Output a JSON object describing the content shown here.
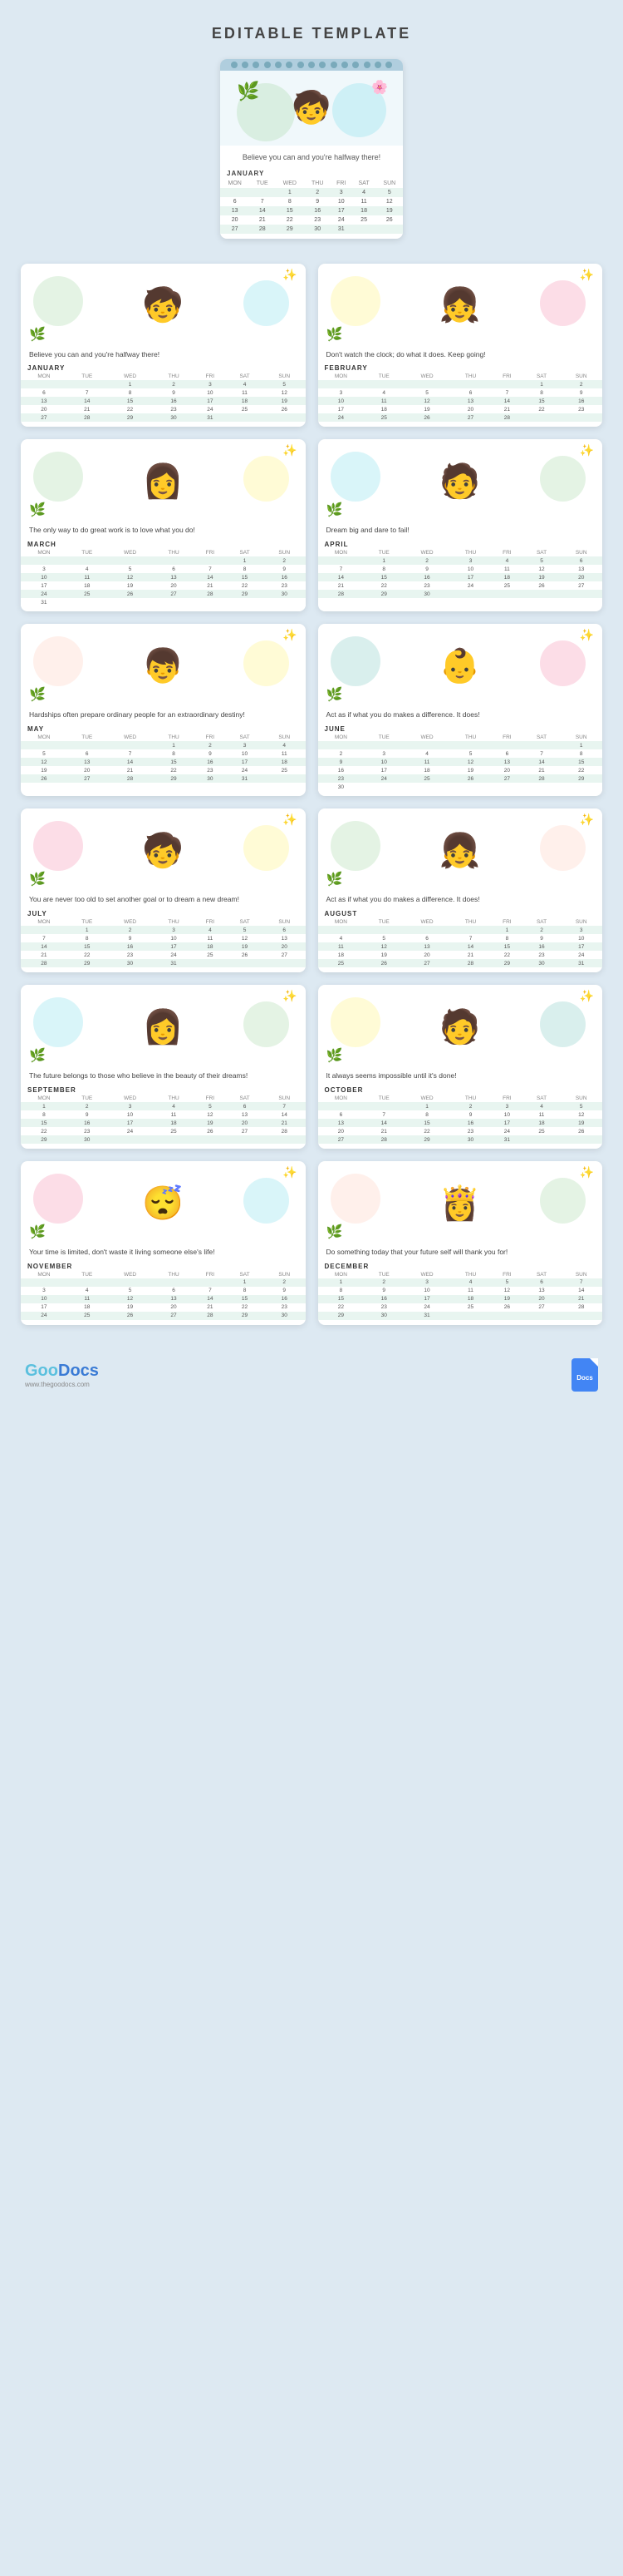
{
  "page": {
    "title": "EDITABLE TEMPLATE",
    "bg_color": "#dde9f2"
  },
  "hero": {
    "quote": "Believe you can\nand you're halfway there!",
    "month": "JANUARY",
    "days": [
      "MON",
      "TUE",
      "WED",
      "THU",
      "FRI",
      "SAT",
      "SUN"
    ],
    "weeks": [
      [
        "",
        "",
        "1",
        "2",
        "3",
        "4",
        "5"
      ],
      [
        "6",
        "7",
        "8",
        "9",
        "10",
        "11",
        "12"
      ],
      [
        "13",
        "14",
        "15",
        "16",
        "17",
        "18",
        "19"
      ],
      [
        "20",
        "21",
        "22",
        "23",
        "24",
        "25",
        "26"
      ],
      [
        "27",
        "28",
        "29",
        "30",
        "31",
        "",
        ""
      ]
    ]
  },
  "cards": [
    {
      "id": "jan",
      "quote": "Believe you can\nand you're halfway there!",
      "month": "JANUARY",
      "days": [
        "MON",
        "TUE",
        "WED",
        "THU",
        "FRI",
        "SAT",
        "SUN"
      ],
      "weeks": [
        [
          "",
          "",
          "1",
          "2",
          "3",
          "4",
          "5"
        ],
        [
          "6",
          "7",
          "8",
          "9",
          "10",
          "11",
          "12"
        ],
        [
          "13",
          "14",
          "15",
          "16",
          "17",
          "18",
          "19"
        ],
        [
          "20",
          "21",
          "22",
          "23",
          "24",
          "25",
          "26"
        ],
        [
          "27",
          "28",
          "29",
          "30",
          "31",
          "",
          ""
        ]
      ],
      "emoji": "🧒",
      "blob1": "blob-green",
      "blob2": "blob-blue"
    },
    {
      "id": "feb",
      "quote": "Don't watch the clock; do what it\ndoes. Keep going!",
      "month": "FEBRUARY",
      "days": [
        "MON",
        "TUE",
        "WED",
        "THU",
        "FRI",
        "SAT",
        "SUN"
      ],
      "weeks": [
        [
          "",
          "",
          "",
          "",
          "",
          "1",
          "2"
        ],
        [
          "3",
          "4",
          "5",
          "6",
          "7",
          "8",
          "9"
        ],
        [
          "10",
          "11",
          "12",
          "13",
          "14",
          "15",
          "16"
        ],
        [
          "17",
          "18",
          "19",
          "20",
          "21",
          "22",
          "23"
        ],
        [
          "24",
          "25",
          "26",
          "27",
          "28",
          "",
          ""
        ]
      ],
      "emoji": "👧",
      "blob1": "blob-yellow",
      "blob2": "blob-pink"
    },
    {
      "id": "mar",
      "quote": "The only way to do great work is\nto love what you do!",
      "month": "MARCH",
      "days": [
        "MON",
        "TUE",
        "WED",
        "THU",
        "FRI",
        "SAT",
        "SUN"
      ],
      "weeks": [
        [
          "",
          "",
          "",
          "",
          "",
          "1",
          "2"
        ],
        [
          "3",
          "4",
          "5",
          "6",
          "7",
          "8",
          "9"
        ],
        [
          "10",
          "11",
          "12",
          "13",
          "14",
          "15",
          "16"
        ],
        [
          "17",
          "18",
          "19",
          "20",
          "21",
          "22",
          "23"
        ],
        [
          "24",
          "25",
          "26",
          "27",
          "28",
          "29",
          "30"
        ],
        [
          "31",
          "",
          "",
          "",
          "",
          "",
          ""
        ]
      ],
      "emoji": "👩",
      "blob1": "blob-green",
      "blob2": "blob-yellow"
    },
    {
      "id": "apr",
      "quote": "Dream big and dare to fail!",
      "month": "APRIL",
      "days": [
        "MON",
        "TUE",
        "WED",
        "THU",
        "FRI",
        "SAT",
        "SUN"
      ],
      "weeks": [
        [
          "",
          "1",
          "2",
          "3",
          "4",
          "5",
          "6"
        ],
        [
          "7",
          "8",
          "9",
          "10",
          "11",
          "12",
          "13"
        ],
        [
          "14",
          "15",
          "16",
          "17",
          "18",
          "19",
          "20"
        ],
        [
          "21",
          "22",
          "23",
          "24",
          "25",
          "26",
          "27"
        ],
        [
          "28",
          "29",
          "30",
          "",
          "",
          "",
          ""
        ]
      ],
      "emoji": "🧑",
      "blob1": "blob-blue",
      "blob2": "blob-green"
    },
    {
      "id": "may",
      "quote": "Hardships often prepare ordinary\npeople for an extraordinary destiny!",
      "month": "MAY",
      "days": [
        "MON",
        "TUE",
        "WED",
        "THU",
        "FRI",
        "SAT",
        "SUN"
      ],
      "weeks": [
        [
          "",
          "",
          "",
          "1",
          "2",
          "3",
          "4"
        ],
        [
          "5",
          "6",
          "7",
          "8",
          "9",
          "10",
          "11"
        ],
        [
          "12",
          "13",
          "14",
          "15",
          "16",
          "17",
          "18"
        ],
        [
          "19",
          "20",
          "21",
          "22",
          "23",
          "24",
          "25"
        ],
        [
          "26",
          "27",
          "28",
          "29",
          "30",
          "31",
          ""
        ]
      ],
      "emoji": "👦",
      "blob1": "blob-peach",
      "blob2": "blob-yellow"
    },
    {
      "id": "jun",
      "quote": "Act as if what you do makes a\ndifference. It does!",
      "month": "JUNE",
      "days": [
        "MON",
        "TUE",
        "WED",
        "THU",
        "FRI",
        "SAT",
        "SUN"
      ],
      "weeks": [
        [
          "",
          "",
          "",
          "",
          "",
          "",
          "1"
        ],
        [
          "2",
          "3",
          "4",
          "5",
          "6",
          "7",
          "8"
        ],
        [
          "9",
          "10",
          "11",
          "12",
          "13",
          "14",
          "15"
        ],
        [
          "16",
          "17",
          "18",
          "19",
          "20",
          "21",
          "22"
        ],
        [
          "23",
          "24",
          "25",
          "26",
          "27",
          "28",
          "29"
        ],
        [
          "30",
          "",
          "",
          "",
          "",
          "",
          ""
        ]
      ],
      "emoji": "👶",
      "blob1": "blob-teal",
      "blob2": "blob-pink"
    },
    {
      "id": "jul",
      "quote": "You are never too old to set\nanother goal or to dream a new\ndream!",
      "month": "JULY",
      "days": [
        "MON",
        "TUE",
        "WED",
        "THU",
        "FRI",
        "SAT",
        "SUN"
      ],
      "weeks": [
        [
          "",
          "1",
          "2",
          "3",
          "4",
          "5",
          "6"
        ],
        [
          "7",
          "8",
          "9",
          "10",
          "11",
          "12",
          "13"
        ],
        [
          "14",
          "15",
          "16",
          "17",
          "18",
          "19",
          "20"
        ],
        [
          "21",
          "22",
          "23",
          "24",
          "25",
          "26",
          "27"
        ],
        [
          "28",
          "29",
          "30",
          "31",
          "",
          "",
          ""
        ]
      ],
      "emoji": "🧒",
      "blob1": "blob-pink",
      "blob2": "blob-yellow"
    },
    {
      "id": "aug",
      "quote": "Act as if what you do makes a\ndifference. It does!",
      "month": "AUGUST",
      "days": [
        "MON",
        "TUE",
        "WED",
        "THU",
        "FRI",
        "SAT",
        "SUN"
      ],
      "weeks": [
        [
          "",
          "",
          "",
          "",
          "1",
          "2",
          "3"
        ],
        [
          "4",
          "5",
          "6",
          "7",
          "8",
          "9",
          "10"
        ],
        [
          "11",
          "12",
          "13",
          "14",
          "15",
          "16",
          "17"
        ],
        [
          "18",
          "19",
          "20",
          "21",
          "22",
          "23",
          "24"
        ],
        [
          "25",
          "26",
          "27",
          "28",
          "29",
          "30",
          "31"
        ]
      ],
      "emoji": "👧",
      "blob1": "blob-green",
      "blob2": "blob-peach"
    },
    {
      "id": "sep",
      "quote": "The future belongs to those who\nbelieve in the beauty of their dreams!",
      "month": "SEPTEMBER",
      "days": [
        "MON",
        "TUE",
        "WED",
        "THU",
        "FRI",
        "SAT",
        "SUN"
      ],
      "weeks": [
        [
          "1",
          "2",
          "3",
          "4",
          "5",
          "6",
          "7"
        ],
        [
          "8",
          "9",
          "10",
          "11",
          "12",
          "13",
          "14"
        ],
        [
          "15",
          "16",
          "17",
          "18",
          "19",
          "20",
          "21"
        ],
        [
          "22",
          "23",
          "24",
          "25",
          "26",
          "27",
          "28"
        ],
        [
          "29",
          "30",
          "",
          "",
          "",
          "",
          ""
        ]
      ],
      "emoji": "👩",
      "blob1": "blob-blue",
      "blob2": "blob-green"
    },
    {
      "id": "oct",
      "quote": "It always seems impossible until it's\ndone!",
      "month": "OCTOBER",
      "days": [
        "MON",
        "TUE",
        "WED",
        "THU",
        "FRI",
        "SAT",
        "SUN"
      ],
      "weeks": [
        [
          "",
          "",
          "1",
          "2",
          "3",
          "4",
          "5"
        ],
        [
          "6",
          "7",
          "8",
          "9",
          "10",
          "11",
          "12"
        ],
        [
          "13",
          "14",
          "15",
          "16",
          "17",
          "18",
          "19"
        ],
        [
          "20",
          "21",
          "22",
          "23",
          "24",
          "25",
          "26"
        ],
        [
          "27",
          "28",
          "29",
          "30",
          "31",
          "",
          ""
        ]
      ],
      "emoji": "🧑",
      "blob1": "blob-yellow",
      "blob2": "blob-teal"
    },
    {
      "id": "nov",
      "quote": "Your time is limited, don't waste it\nliving someone else's life!",
      "month": "NOVEMBER",
      "days": [
        "MON",
        "TUE",
        "WED",
        "THU",
        "FRI",
        "SAT",
        "SUN"
      ],
      "weeks": [
        [
          "",
          "",
          "",
          "",
          "",
          "1",
          "2"
        ],
        [
          "3",
          "4",
          "5",
          "6",
          "7",
          "8",
          "9"
        ],
        [
          "10",
          "11",
          "12",
          "13",
          "14",
          "15",
          "16"
        ],
        [
          "17",
          "18",
          "19",
          "20",
          "21",
          "22",
          "23"
        ],
        [
          "24",
          "25",
          "26",
          "27",
          "28",
          "29",
          "30"
        ]
      ],
      "emoji": "😴",
      "blob1": "blob-pink",
      "blob2": "blob-blue"
    },
    {
      "id": "dec",
      "quote": "Do something today that your future\nself will thank you for!",
      "month": "DECEMBER",
      "days": [
        "MON",
        "TUE",
        "WED",
        "THU",
        "FRI",
        "SAT",
        "SUN"
      ],
      "weeks": [
        [
          "1",
          "2",
          "3",
          "4",
          "5",
          "6",
          "7"
        ],
        [
          "8",
          "9",
          "10",
          "11",
          "12",
          "13",
          "14"
        ],
        [
          "15",
          "16",
          "17",
          "18",
          "19",
          "20",
          "21"
        ],
        [
          "22",
          "23",
          "24",
          "25",
          "26",
          "27",
          "28"
        ],
        [
          "29",
          "30",
          "31",
          "",
          "",
          "",
          ""
        ]
      ],
      "emoji": "👸",
      "blob1": "blob-peach",
      "blob2": "blob-green"
    }
  ],
  "footer": {
    "logo": "GooDocs",
    "logo_sub": "www.thegoodocs.com",
    "docs_label": "Docs"
  }
}
